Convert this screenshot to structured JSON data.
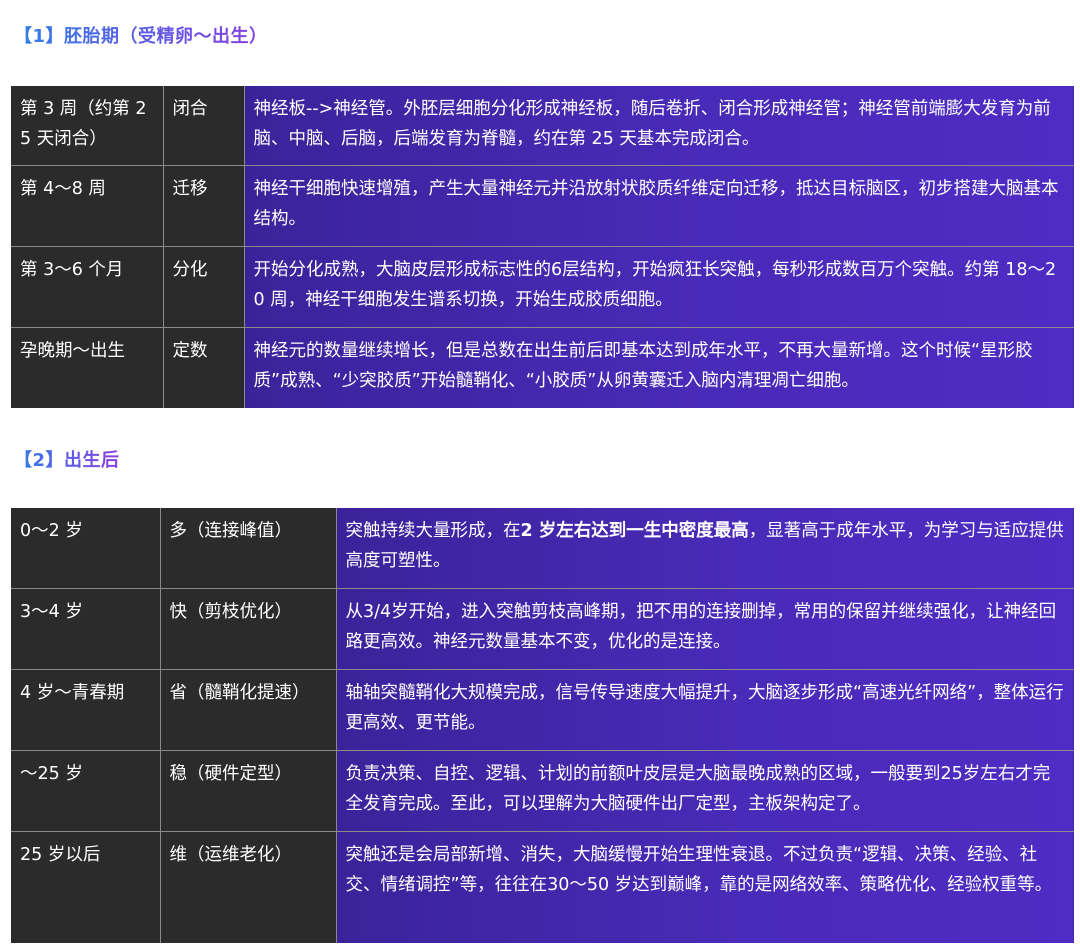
{
  "section1": {
    "title": "【1】胚胎期（受精卵～出生）",
    "rows": [
      {
        "period": "第 3 周（约第 25 天闭合）",
        "key": "闭合",
        "desc": "神经板-->神经管。外胚层细胞分化形成神经板，随后卷折、闭合形成神经管；神经管前端膨大发育为前脑、中脑、后脑，后端发育为脊髓，约在第 25 天基本完成闭合。"
      },
      {
        "period": "第 4～8 周",
        "key": "迁移",
        "desc": "神经干细胞快速增殖，产生大量神经元并沿放射状胶质纤维定向迁移，抵达目标脑区，初步搭建大脑基本结构。"
      },
      {
        "period": "第 3～6 个月",
        "key": "分化",
        "desc": "开始分化成熟，大脑皮层形成标志性的6层结构，开始疯狂长突触，每秒形成数百万个突触。约第 18～20 周，神经干细胞发生谱系切换，开始生成胶质细胞。"
      },
      {
        "period": "孕晚期～出生",
        "key": "定数",
        "desc": "神经元的数量继续增长，但是总数在出生前后即基本达到成年水平，不再大量新增。这个时候“星形胶质”成熟、“少突胶质”开始髓鞘化、“小胶质”从卵黄囊迁入脑内清理凋亡细胞。"
      }
    ]
  },
  "section2": {
    "title": "【2】出生后",
    "rows": [
      {
        "period": "0～2 岁",
        "key": "多（连接峰值）",
        "desc_pre": "突触持续大量形成，在",
        "desc_bold": "2 岁左右达到一生中密度最高",
        "desc_post": "，显著高于成年水平，为学习与适应提供高度可塑性。"
      },
      {
        "period": "3～4 岁",
        "key": "快（剪枝优化）",
        "desc": "从3/4岁开始，进入突触剪枝高峰期，把不用的连接删掉，常用的保留并继续强化，让神经回路更高效。神经元数量基本不变，优化的是连接。"
      },
      {
        "period": "4 岁～青春期",
        "key": "省（髓鞘化提速）",
        "desc": "轴轴突髓鞘化大规模完成，信号传导速度大幅提升，大脑逐步形成“高速光纤网络”，整体运行更高效、更节能。"
      },
      {
        "period": "～25 岁",
        "key": "稳（硬件定型）",
        "desc": "负责决策、自控、逻辑、计划的前额叶皮层是大脑最晚成熟的区域，一般要到25岁左右才完全发育完成。至此，可以理解为大脑硬件出厂定型，主板架构定了。"
      },
      {
        "period": "25 岁以后",
        "key": "维（运维老化）",
        "desc": "突触还是会局部新增、消失，大脑缓慢开始生理性衰退。不过负责“逻辑、决策、经验、社交、情绪调控”等，往往在30～50 岁达到巅峰，靠的是网络效率、策略优化、经验权重等。"
      }
    ]
  },
  "colors": {
    "title_gradient_start": "#2f7fe8",
    "title_gradient_end": "#8a3ce0",
    "dark_cell": "#2b2b2b",
    "purple_cell": "#4a2ab8"
  }
}
